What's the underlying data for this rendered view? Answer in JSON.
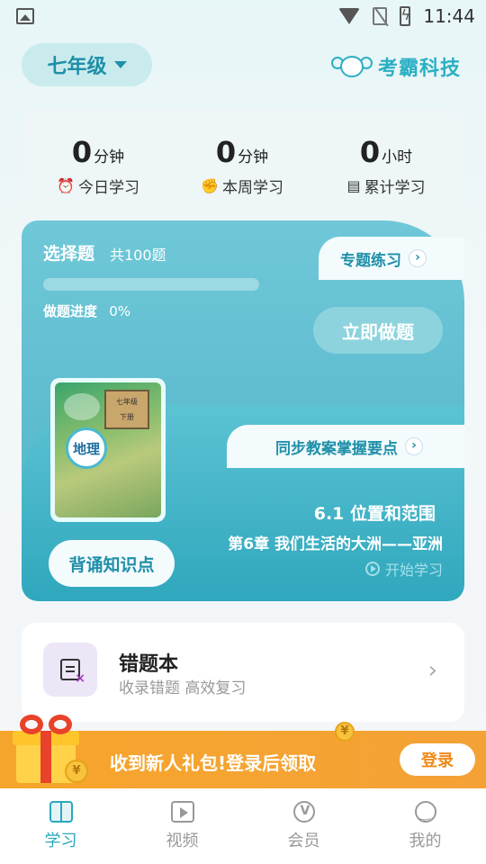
{
  "status_bar": {
    "time": "11:44"
  },
  "header": {
    "grade": "七年级",
    "brand": "考霸科技"
  },
  "stats": [
    {
      "value": "0",
      "unit": "分钟",
      "icon": "alarm-clock-icon",
      "label": "今日学习"
    },
    {
      "value": "0",
      "unit": "分钟",
      "icon": "flexed-bicep-icon",
      "label": "本周学习"
    },
    {
      "value": "0",
      "unit": "小时",
      "icon": "clipboard-icon",
      "label": "累计学习"
    }
  ],
  "quiz": {
    "title": "选择题",
    "total": "共100题",
    "topic_tab": "专题练习",
    "progress_label": "做题进度",
    "progress_value": "0%",
    "start_button": "立即做题"
  },
  "book": {
    "sync_tab": "同步教案掌握要点",
    "cover_grade": "七年级",
    "cover_term": "下册",
    "cover_subject": "地理",
    "lesson": "6.1 位置和范围",
    "chapter": "第6章 我们生活的大洲——亚洲",
    "start_learning": "开始学习",
    "recite_button": "背诵知识点"
  },
  "wrong_book": {
    "title": "错题本",
    "subtitle": "收录错题 高效复习"
  },
  "promo": {
    "text": "收到新人礼包!登录后领取",
    "login_button": "登录",
    "coin_symbol": "¥"
  },
  "tabs": [
    {
      "label": "学习",
      "active": true
    },
    {
      "label": "视频",
      "active": false
    },
    {
      "label": "会员",
      "active": false
    },
    {
      "label": "我的",
      "active": false
    }
  ]
}
